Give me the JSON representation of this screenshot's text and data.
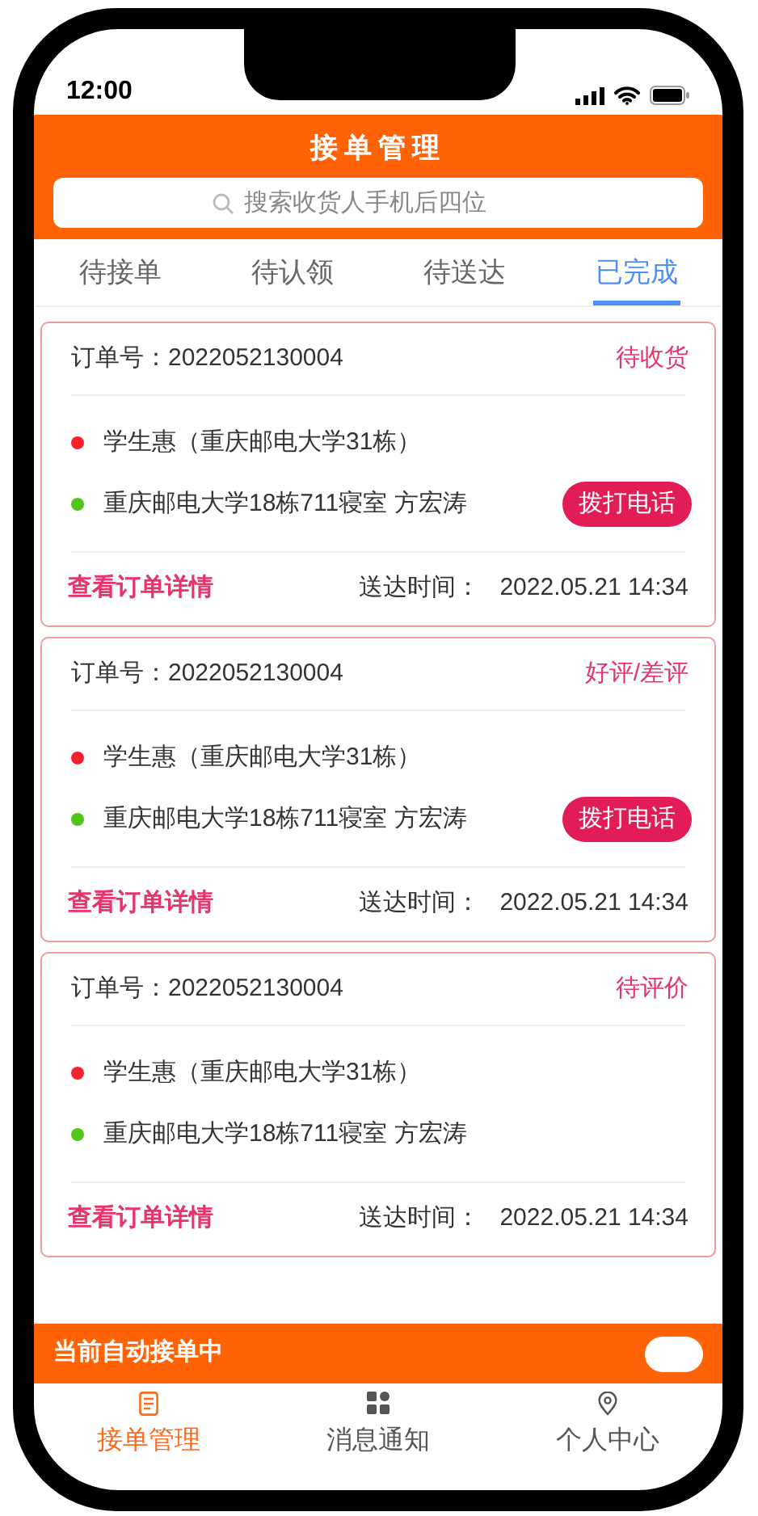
{
  "status_bar": {
    "time": "12:00"
  },
  "header": {
    "title": "接单管理",
    "search": {
      "placeholder": "搜索收货人手机后四位"
    }
  },
  "tabs": [
    {
      "label": "待接单",
      "selected": false
    },
    {
      "label": "待认领",
      "selected": false
    },
    {
      "label": "待送达",
      "selected": false
    },
    {
      "label": "已完成",
      "selected": true
    }
  ],
  "orders": [
    {
      "order_label": "订单号：",
      "order_no": "2022052130004",
      "status": "待收货",
      "pickup": {
        "text": "学生惠（重庆邮电大学31栋）",
        "color": "#f5222d"
      },
      "dropoff": {
        "text": "重庆邮电大学18栋711寝室 方宏涛",
        "color": "#52c41a"
      },
      "call_button": "拨打电话",
      "detail_link": "查看订单详情",
      "time_label": "送达时间：",
      "time": "2022.05.21 14:34"
    },
    {
      "order_label": "订单号：",
      "order_no": "2022052130004",
      "status": "好评/差评",
      "pickup": {
        "text": "学生惠（重庆邮电大学31栋）",
        "color": "#f5222d"
      },
      "dropoff": {
        "text": "重庆邮电大学18栋711寝室 方宏涛",
        "color": "#52c41a"
      },
      "call_button": "拨打电话",
      "detail_link": "查看订单详情",
      "time_label": "送达时间：",
      "time": "2022.05.21 14:34"
    },
    {
      "order_label": "订单号：",
      "order_no": "2022052130004",
      "status": "待评价",
      "pickup": {
        "text": "学生惠（重庆邮电大学31栋）",
        "color": "#f5222d"
      },
      "dropoff": {
        "text": "重庆邮电大学18栋711寝室 方宏涛",
        "color": "#52c41a"
      },
      "detail_link": "查看订单详情",
      "time_label": "送达时间：",
      "time": "2022.05.21 14:34"
    }
  ],
  "auto_accept": {
    "label": "当前自动接单中",
    "on": true
  },
  "bottom_nav": [
    {
      "label": "接单管理",
      "kind": "doc",
      "selected": true
    },
    {
      "label": "消息通知",
      "kind": "grid",
      "selected": false
    },
    {
      "label": "个人中心",
      "kind": "pin",
      "selected": false
    }
  ]
}
